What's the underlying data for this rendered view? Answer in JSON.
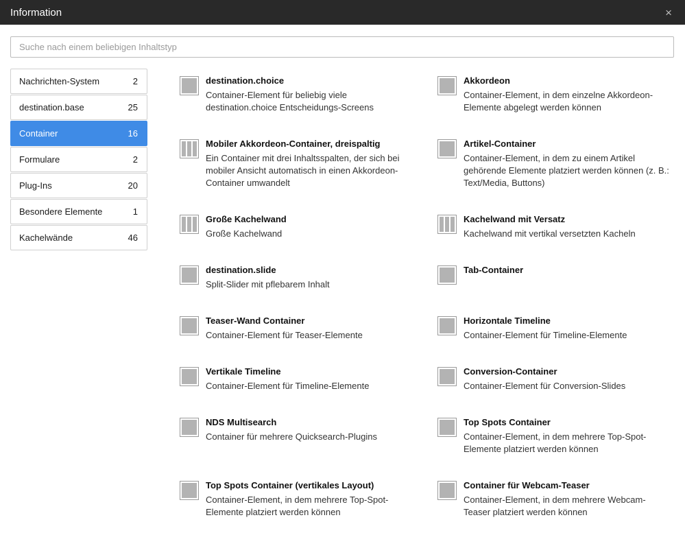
{
  "window": {
    "title": "Information",
    "close_glyph": "×"
  },
  "search": {
    "placeholder": "Suche nach einem beliebigen Inhaltstyp"
  },
  "sidebar": {
    "items": [
      {
        "label": "Nachrichten-System",
        "count": "2"
      },
      {
        "label": "destination.base",
        "count": "25"
      },
      {
        "label": "Container",
        "count": "16",
        "active": true
      },
      {
        "label": "Formulare",
        "count": "2"
      },
      {
        "label": "Plug-Ins",
        "count": "20"
      },
      {
        "label": "Besondere Elemente",
        "count": "1"
      },
      {
        "label": "Kachelwände",
        "count": "46"
      }
    ]
  },
  "elements": [
    {
      "icon": "single-column-icon",
      "name": "destination.choice",
      "desc": "Container-Element für beliebig viele destination.choice Entscheidungs-Screens"
    },
    {
      "icon": "single-column-icon",
      "name": "Akkordeon",
      "desc": "Container-Element, in dem einzelne Akkordeon-Elemente abgelegt werden können"
    },
    {
      "icon": "three-column-icon",
      "name": "Mobiler Akkordeon-Container, dreispaltig",
      "desc": "Ein Container mit drei Inhaltsspalten, der sich bei mobiler Ansicht automatisch in einen Akkordeon-Container umwandelt"
    },
    {
      "icon": "single-column-icon",
      "name": "Artikel-Container",
      "desc": "Container-Element, in dem zu einem Artikel gehörende Elemente platziert werden können (z. B.: Text/Media, Buttons)"
    },
    {
      "icon": "three-column-icon",
      "name": "Große Kachelwand",
      "desc": "Große Kachelwand"
    },
    {
      "icon": "three-column-icon",
      "name": "Kachelwand mit Versatz",
      "desc": "Kachelwand mit vertikal versetzten Kacheln"
    },
    {
      "icon": "single-column-icon",
      "name": "destination.slide",
      "desc": "Split-Slider mit pflebarem Inhalt"
    },
    {
      "icon": "single-column-icon",
      "name": "Tab-Container",
      "desc": ""
    },
    {
      "icon": "single-column-icon",
      "name": "Teaser-Wand Container",
      "desc": "Container-Element für Teaser-Elemente"
    },
    {
      "icon": "single-column-icon",
      "name": "Horizontale Timeline",
      "desc": "Container-Element für Timeline-Elemente"
    },
    {
      "icon": "single-column-icon",
      "name": "Vertikale Timeline",
      "desc": "Container-Element für Timeline-Elemente"
    },
    {
      "icon": "single-column-icon",
      "name": "Conversion-Container",
      "desc": "Container-Element für Conversion-Slides"
    },
    {
      "icon": "single-column-icon",
      "name": "NDS Multisearch",
      "desc": "Container für mehrere Quicksearch-Plugins"
    },
    {
      "icon": "single-column-icon",
      "name": "Top Spots Container",
      "desc": "Container-Element, in dem mehrere Top-Spot-Elemente platziert werden können"
    },
    {
      "icon": "single-column-icon",
      "name": "Top Spots Container (vertikales Layout)",
      "desc": "Container-Element, in dem mehrere Top-Spot-Elemente platziert werden können"
    },
    {
      "icon": "single-column-icon",
      "name": "Container für Webcam-Teaser",
      "desc": "Container-Element, in dem mehrere Webcam-Teaser platziert werden können"
    }
  ],
  "colors": {
    "titlebar_bg": "#292929",
    "active_accent": "#3f8be6",
    "icon_fill": "#b3b3b3"
  }
}
